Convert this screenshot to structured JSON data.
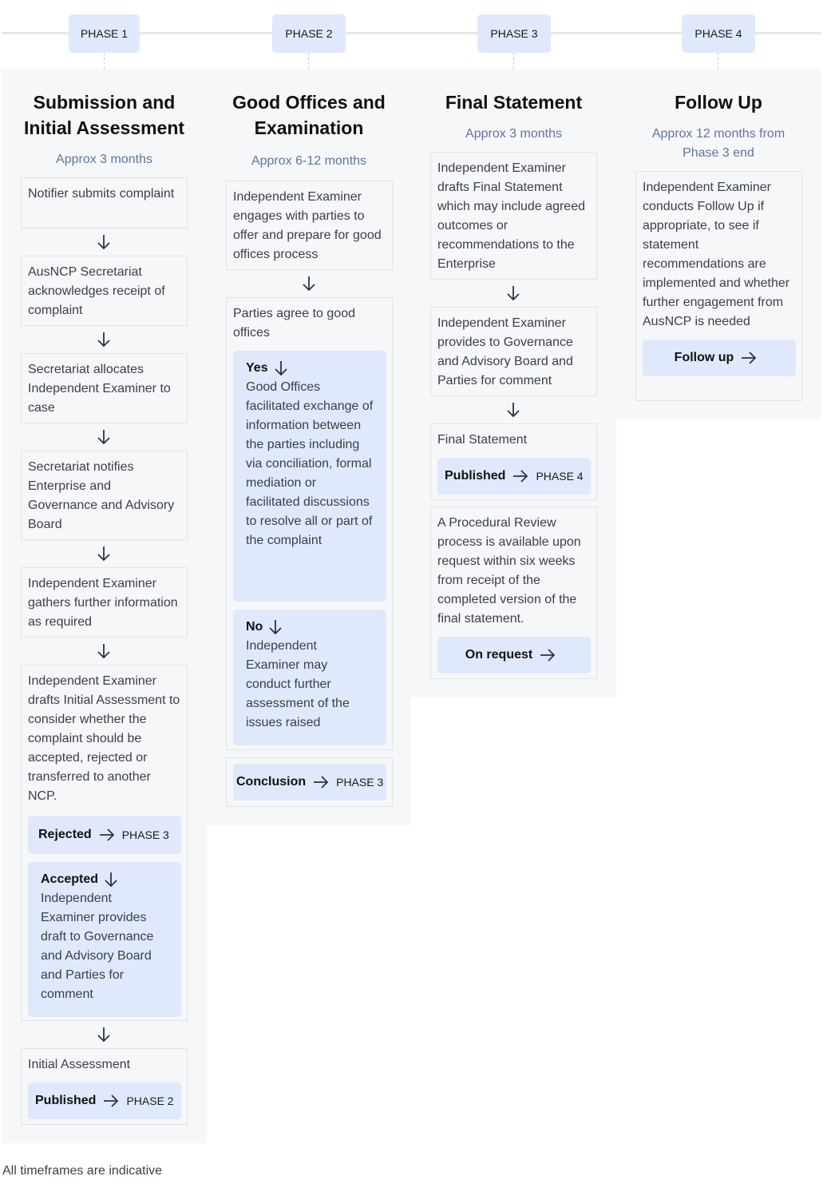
{
  "phases": [
    {
      "badge": "PHASE 1",
      "title_line1": "Submission and",
      "title_line2": "Initial Assessment",
      "duration": "Approx 3 months",
      "steps": [
        "Notifier submits complaint",
        "AusNCP Secretariat acknowledges receipt of complaint",
        "Secretariat allocates Independent Examiner to case",
        "Secretariat notifies Enterprise and Governance and Advisory Board",
        "Independent Examiner gathers further information as required",
        "Independent Examiner drafts Initial Assessment to consider whether the complaint should be accepted, rejected or transferred to another NCP."
      ],
      "rejected": {
        "label": "Rejected",
        "target": "PHASE 3"
      },
      "accepted": {
        "label": "Accepted",
        "text": "Independent Examiner provides draft to Governance and Advisory Board and Parties for comment"
      },
      "outcome": {
        "text": "Initial Assessment",
        "label": "Published",
        "target": "PHASE 2"
      }
    },
    {
      "badge": "PHASE 2",
      "title_line1": "Good Offices and",
      "title_line2": "Examination",
      "duration": "Approx 6-12 months",
      "steps": [
        "Independent Examiner engages with parties to offer and prepare for good offices process",
        "Parties agree to good offices"
      ],
      "yes": {
        "label": "Yes",
        "text": "Good Offices facilitated exchange of information between the parties including via conciliation, formal mediation or facilitated discussions to resolve all or part of the complaint"
      },
      "no": {
        "label": "No",
        "text": "Independent Examiner may conduct further assessment of the issues raised"
      },
      "outcome": {
        "label": "Conclusion",
        "target": "PHASE 3"
      }
    },
    {
      "badge": "PHASE 3",
      "title_line1": "Final Statement",
      "duration": "Approx 3 months",
      "steps": [
        "Independent Examiner drafts Final Statement which may include agreed outcomes or recommendations to the Enterprise",
        "Independent Examiner provides to Governance and Advisory Board and Parties for comment"
      ],
      "outcome": {
        "text": "Final Statement",
        "label": "Published",
        "target": "PHASE 4"
      },
      "review": {
        "text": "A Procedural Review process is available upon request within six weeks from receipt of the completed version of the final statement.",
        "label": "On request"
      }
    },
    {
      "badge": "PHASE 4",
      "title_line1": "Follow Up",
      "duration_line1": "Approx 12 months from",
      "duration_line2": "Phase 3 end",
      "steps": [
        "Independent Examiner conducts Follow Up if appropriate, to see if statement recommendations are implemented and whether further engagement from AusNCP is needed"
      ],
      "action": {
        "label": "Follow up"
      }
    }
  ],
  "footer": "All timeframes are indicative",
  "colors": {
    "chip_bg": "#dfe9fb",
    "panel_bg": "#f6f7f9",
    "subtitle": "#5d76a0"
  }
}
